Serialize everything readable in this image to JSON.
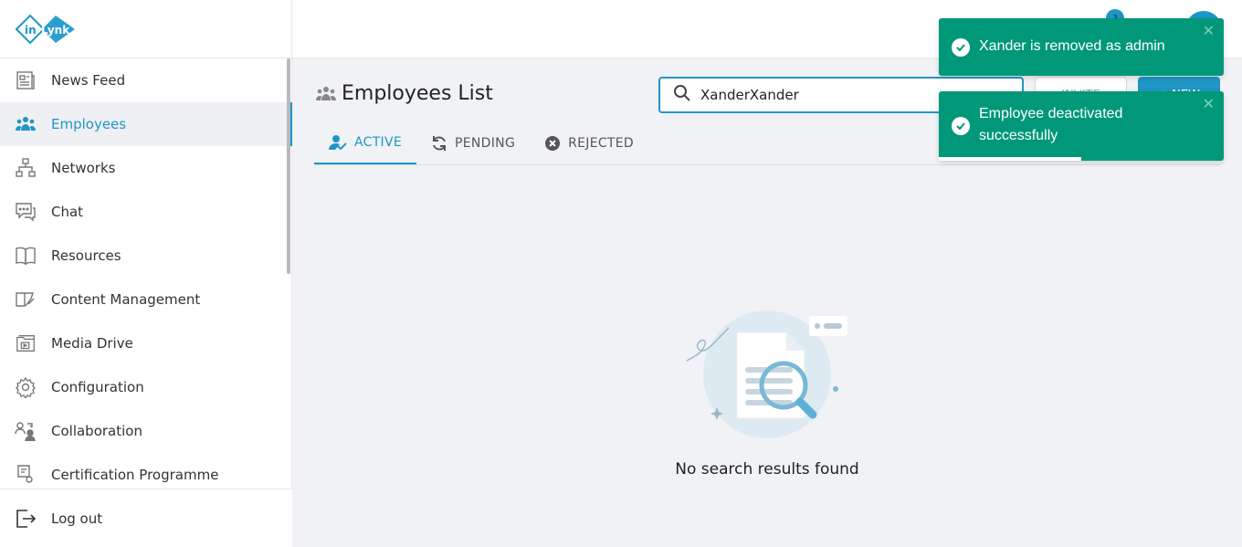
{
  "app": {
    "logo_text_1": "in",
    "logo_text_2": "Lynk",
    "accent": "#1f96c6",
    "toast_color": "#009879"
  },
  "sidebar": {
    "items": [
      {
        "label": "News Feed",
        "icon": "news-feed-icon",
        "active": false
      },
      {
        "label": "Employees",
        "icon": "employees-icon",
        "active": true
      },
      {
        "label": "Networks",
        "icon": "networks-icon",
        "active": false
      },
      {
        "label": "Chat",
        "icon": "chat-icon",
        "active": false
      },
      {
        "label": "Resources",
        "icon": "book-icon",
        "active": false
      },
      {
        "label": "Content Management",
        "icon": "content-icon",
        "active": false
      },
      {
        "label": "Media Drive",
        "icon": "folder-icon",
        "active": false
      },
      {
        "label": "Configuration",
        "icon": "gear-icon",
        "active": false
      },
      {
        "label": "Collaboration",
        "icon": "collaboration-icon",
        "active": false
      },
      {
        "label": "Certification Programme",
        "icon": "certificate-icon",
        "active": false
      }
    ],
    "logout_label": "Log out"
  },
  "topbar": {
    "notification_count": "3"
  },
  "main": {
    "title": "Employees List",
    "search_value": "XanderXander",
    "invite_label": "INVITE",
    "new_label": "+ NEW",
    "tabs": [
      {
        "label": "ACTIVE",
        "icon": "user-check-icon"
      },
      {
        "label": "PENDING",
        "icon": "refresh-icon"
      },
      {
        "label": "REJECTED",
        "icon": "close-circle-icon"
      }
    ],
    "empty_text": "No search results found"
  },
  "toasts": [
    {
      "message": "Xander is removed as admin"
    },
    {
      "message": "Employee deactivated successfully",
      "progress": 0.5
    }
  ]
}
